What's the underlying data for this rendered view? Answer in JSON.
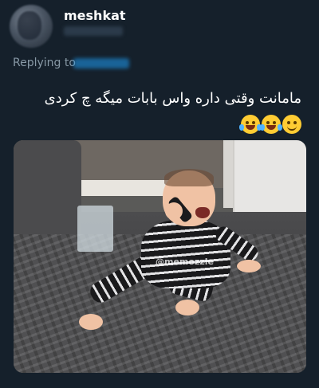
{
  "tweet": {
    "username": "meshkat",
    "replying_label": "Replying to",
    "text": "مامانت وقتی داره واس بابات میگه چ کردی",
    "emojis": [
      "face-with-tears-of-joy-icon",
      "face-with-tears-of-joy-icon",
      "slightly-smiling-face-icon"
    ]
  },
  "media": {
    "watermark": "@memozzle"
  },
  "colors": {
    "background": "#15202b",
    "secondary_text": "#8899a6",
    "link": "#1d9bf0"
  }
}
